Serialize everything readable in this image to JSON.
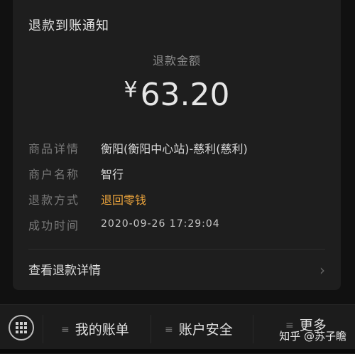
{
  "card": {
    "title": "退款到账通知",
    "amount_label": "退款金额",
    "currency": "¥",
    "amount": "63.20",
    "rows": [
      {
        "key": "商品详情",
        "value": "衡阳(衡阳中心站)-慈利(慈利)"
      },
      {
        "key": "商户名称",
        "value": "智行"
      },
      {
        "key": "退款方式",
        "value": "退回零钱"
      },
      {
        "key": "成功时间",
        "value": "2020-09-26 17:29:04"
      }
    ],
    "detail_link": "查看退款详情"
  },
  "bottom_bar": {
    "menus": [
      "我的账单",
      "账户安全",
      "更多"
    ]
  },
  "watermark": "知乎 @苏子瞻",
  "colors": {
    "accent": "#e8a23c",
    "background": "#111111",
    "card": "#1e1e1e"
  }
}
